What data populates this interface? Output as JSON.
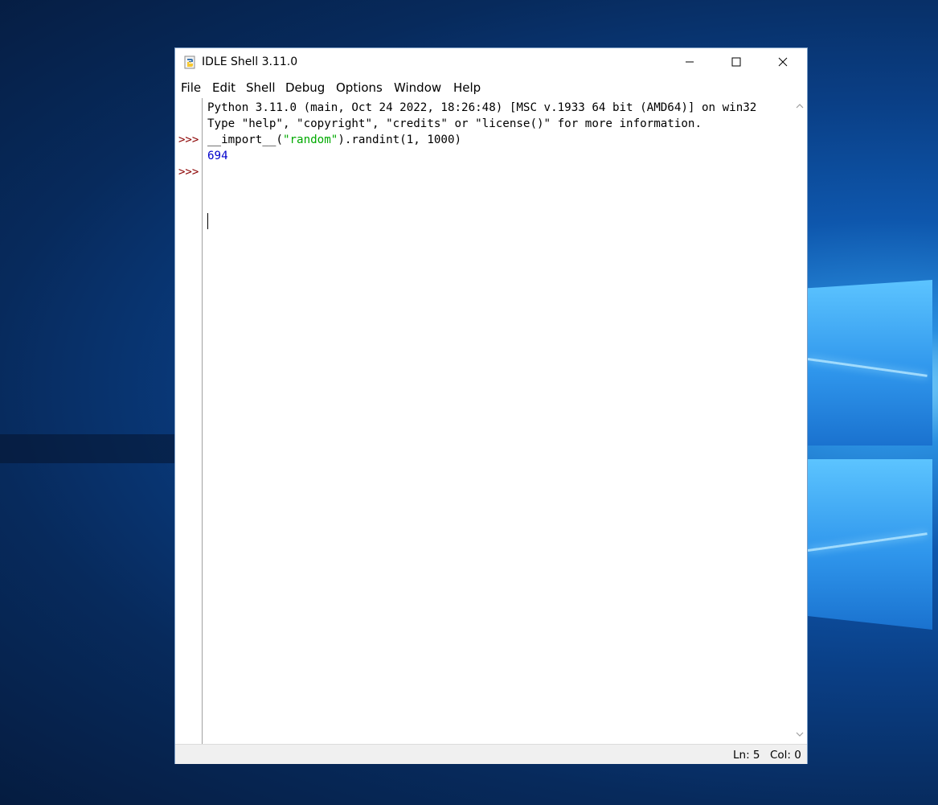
{
  "window": {
    "title": "IDLE Shell 3.11.0"
  },
  "menubar": {
    "items": [
      "File",
      "Edit",
      "Shell",
      "Debug",
      "Options",
      "Window",
      "Help"
    ]
  },
  "shell": {
    "prompt": ">>>",
    "banner_line_1": "Python 3.11.0 (main, Oct 24 2022, 18:26:48) [MSC v.1933 64 bit (AMD64)] on win32",
    "banner_line_2": "Type \"help\", \"copyright\", \"credits\" or \"license()\" for more information.",
    "input_prefix": "__import__(",
    "input_string": "\"random\"",
    "input_suffix": ").randint(1, 1000)",
    "output": "694"
  },
  "statusbar": {
    "line": "Ln: 5",
    "column": "Col: 0"
  },
  "colors": {
    "prompt": "#8b0000",
    "string": "#00aa00",
    "output": "#0000cc"
  },
  "icons": {
    "app": "python-idle-icon",
    "minimize": "minimize-icon",
    "maximize": "maximize-icon",
    "close": "close-icon"
  }
}
